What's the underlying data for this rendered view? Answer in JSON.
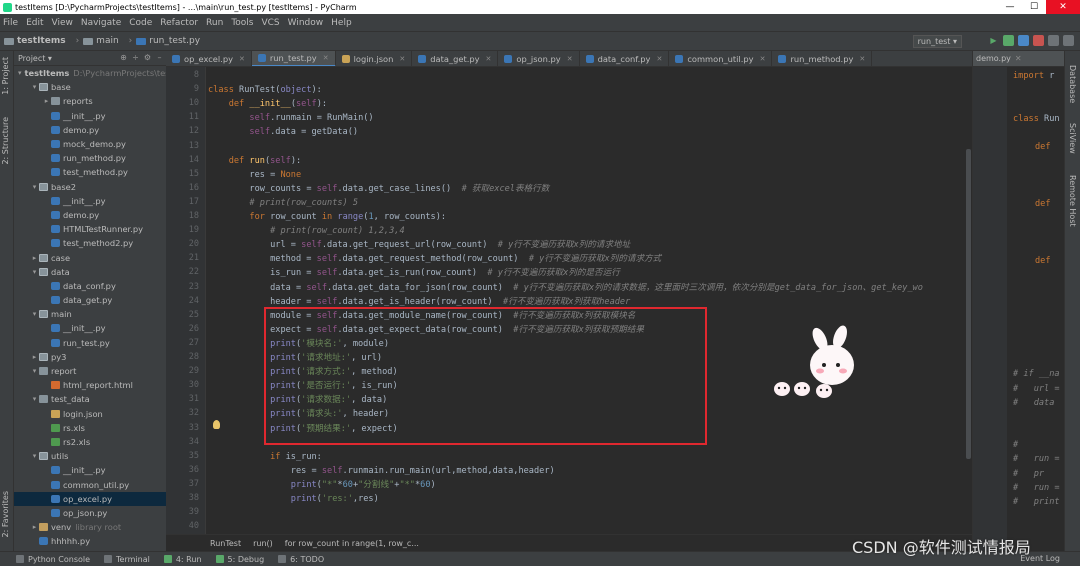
{
  "window": {
    "title": "testItems [D:\\PycharmProjects\\testItems] - ...\\main\\run_test.py [testItems] - PyCharm",
    "min": "—",
    "max": "☐",
    "close": "✕"
  },
  "menu": [
    "File",
    "Edit",
    "View",
    "Navigate",
    "Code",
    "Refactor",
    "Run",
    "Tools",
    "VCS",
    "Window",
    "Help"
  ],
  "breadcrumb": [
    "testItems",
    "main",
    "run_test.py"
  ],
  "run_config": "run_test ▾",
  "project_panel": {
    "header": "Project ▾"
  },
  "left_labels": [
    "1: Project",
    "2: Structure",
    "2: Favorites"
  ],
  "right_labels": [
    "Database",
    "SciView",
    "Remote Host"
  ],
  "tree": [
    {
      "d": 0,
      "a": "▾",
      "i": "folder",
      "t": "testItems",
      "dim": "D:\\PycharmProjects\\testItems",
      "bold": true
    },
    {
      "d": 1,
      "a": "▾",
      "i": "pkg",
      "t": "base"
    },
    {
      "d": 2,
      "a": "▸",
      "i": "folder",
      "t": "reports"
    },
    {
      "d": 2,
      "a": "",
      "i": "py",
      "t": "__init__.py"
    },
    {
      "d": 2,
      "a": "",
      "i": "py",
      "t": "demo.py"
    },
    {
      "d": 2,
      "a": "",
      "i": "py",
      "t": "mock_demo.py"
    },
    {
      "d": 2,
      "a": "",
      "i": "py",
      "t": "run_method.py"
    },
    {
      "d": 2,
      "a": "",
      "i": "py",
      "t": "test_method.py"
    },
    {
      "d": 1,
      "a": "▾",
      "i": "pkg",
      "t": "base2"
    },
    {
      "d": 2,
      "a": "",
      "i": "py",
      "t": "__init__.py"
    },
    {
      "d": 2,
      "a": "",
      "i": "py",
      "t": "demo.py"
    },
    {
      "d": 2,
      "a": "",
      "i": "py",
      "t": "HTMLTestRunner.py"
    },
    {
      "d": 2,
      "a": "",
      "i": "py",
      "t": "test_method2.py"
    },
    {
      "d": 1,
      "a": "▸",
      "i": "pkg",
      "t": "case"
    },
    {
      "d": 1,
      "a": "▾",
      "i": "pkg",
      "t": "data"
    },
    {
      "d": 2,
      "a": "",
      "i": "py",
      "t": "data_conf.py"
    },
    {
      "d": 2,
      "a": "",
      "i": "py",
      "t": "data_get.py"
    },
    {
      "d": 1,
      "a": "▾",
      "i": "pkg",
      "t": "main"
    },
    {
      "d": 2,
      "a": "",
      "i": "py",
      "t": "__init__.py"
    },
    {
      "d": 2,
      "a": "",
      "i": "py",
      "t": "run_test.py"
    },
    {
      "d": 1,
      "a": "▸",
      "i": "pkg",
      "t": "py3"
    },
    {
      "d": 1,
      "a": "▾",
      "i": "folder",
      "t": "report"
    },
    {
      "d": 2,
      "a": "",
      "i": "html",
      "t": "html_report.html"
    },
    {
      "d": 1,
      "a": "▾",
      "i": "folder",
      "t": "test_data"
    },
    {
      "d": 2,
      "a": "",
      "i": "json",
      "t": "login.json"
    },
    {
      "d": 2,
      "a": "",
      "i": "xls",
      "t": "rs.xls"
    },
    {
      "d": 2,
      "a": "",
      "i": "xls",
      "t": "rs2.xls"
    },
    {
      "d": 1,
      "a": "▾",
      "i": "pkg",
      "t": "utils"
    },
    {
      "d": 2,
      "a": "",
      "i": "py",
      "t": "__init__.py"
    },
    {
      "d": 2,
      "a": "",
      "i": "py",
      "t": "common_util.py"
    },
    {
      "d": 2,
      "a": "",
      "i": "py",
      "t": "op_excel.py",
      "sel": true
    },
    {
      "d": 2,
      "a": "",
      "i": "py",
      "t": "op_json.py"
    },
    {
      "d": 1,
      "a": "▸",
      "i": "venv",
      "t": "venv",
      "dim": "library root"
    },
    {
      "d": 1,
      "a": "",
      "i": "py",
      "t": "hhhhh.py"
    }
  ],
  "tabs": [
    {
      "t": "op_excel.py",
      "j": false
    },
    {
      "t": "run_test.py",
      "j": false,
      "active": true
    },
    {
      "t": "login.json",
      "j": true
    },
    {
      "t": "data_get.py",
      "j": false
    },
    {
      "t": "op_json.py",
      "j": false
    },
    {
      "t": "data_conf.py",
      "j": false
    },
    {
      "t": "common_util.py",
      "j": false
    },
    {
      "t": "run_method.py",
      "j": false
    }
  ],
  "code_lines": [
    {
      "n": "8",
      "s": []
    },
    {
      "n": "9",
      "s": [
        [
          "kw",
          "class "
        ],
        [
          "",
          "RunTest("
        ],
        [
          "bi",
          "object"
        ],
        [
          "",
          "):"
        ]
      ]
    },
    {
      "n": "10",
      "s": [
        [
          "ws",
          "    "
        ],
        [
          "kw",
          "def "
        ],
        [
          "fn",
          "__init__"
        ],
        [
          "",
          "("
        ],
        [
          "self",
          "self"
        ],
        [
          "",
          "):"
        ]
      ]
    },
    {
      "n": "11",
      "s": [
        [
          "ws",
          "        "
        ],
        [
          "self",
          "self"
        ],
        [
          "",
          "."
        ],
        [
          "",
          "runmain = RunMain()"
        ]
      ]
    },
    {
      "n": "12",
      "s": [
        [
          "ws",
          "        "
        ],
        [
          "self",
          "self"
        ],
        [
          "",
          ".data = getData()"
        ]
      ]
    },
    {
      "n": "13",
      "s": []
    },
    {
      "n": "14",
      "s": [
        [
          "ws",
          "    "
        ],
        [
          "kw",
          "def "
        ],
        [
          "fn",
          "run"
        ],
        [
          "",
          "("
        ],
        [
          "self",
          "self"
        ],
        [
          "",
          "):"
        ]
      ]
    },
    {
      "n": "15",
      "s": [
        [
          "ws",
          "        "
        ],
        [
          "",
          "res = "
        ],
        [
          "kw",
          "None"
        ]
      ]
    },
    {
      "n": "16",
      "s": [
        [
          "ws",
          "        "
        ],
        [
          "",
          "row_counts = "
        ],
        [
          "self",
          "self"
        ],
        [
          "",
          ".data.get_case_lines()  "
        ],
        [
          "cm",
          "# 获取excel表格行数"
        ]
      ]
    },
    {
      "n": "17",
      "s": [
        [
          "ws",
          "        "
        ],
        [
          "cm",
          "# print(row_counts) 5"
        ]
      ]
    },
    {
      "n": "18",
      "s": [
        [
          "ws",
          "        "
        ],
        [
          "kw",
          "for "
        ],
        [
          "",
          "row_count "
        ],
        [
          "kw",
          "in "
        ],
        [
          "bi",
          "range"
        ],
        [
          "",
          "("
        ],
        [
          "num",
          "1"
        ],
        [
          "",
          ", row_counts):"
        ]
      ]
    },
    {
      "n": "19",
      "s": [
        [
          "ws",
          "            "
        ],
        [
          "cm",
          "# print(row_count) 1,2,3,4"
        ]
      ]
    },
    {
      "n": "20",
      "s": [
        [
          "ws",
          "            "
        ],
        [
          "",
          "url = "
        ],
        [
          "self",
          "self"
        ],
        [
          "",
          ".data.get_request_url(row_count)  "
        ],
        [
          "cm",
          "# y行不变遍历获取x列的请求地址"
        ]
      ]
    },
    {
      "n": "21",
      "s": [
        [
          "ws",
          "            "
        ],
        [
          "",
          "method = "
        ],
        [
          "self",
          "self"
        ],
        [
          "",
          ".data.get_request_method(row_count)  "
        ],
        [
          "cm",
          "# y行不变遍历获取x列的请求方式"
        ]
      ]
    },
    {
      "n": "22",
      "s": [
        [
          "ws",
          "            "
        ],
        [
          "",
          "is_run = "
        ],
        [
          "self",
          "self"
        ],
        [
          "",
          ".data.get_is_run(row_count)  "
        ],
        [
          "cm",
          "# y行不变遍历获取x列的是否运行"
        ]
      ]
    },
    {
      "n": "23",
      "s": [
        [
          "ws",
          "            "
        ],
        [
          "",
          "data = "
        ],
        [
          "self",
          "self"
        ],
        [
          "",
          ".data.get_data_for_json(row_count)  "
        ],
        [
          "cm",
          "# y行不变遍历获取x列的请求数据，这里面时三次调用，依次分别是get_data_for_json、get_key_wo"
        ]
      ]
    },
    {
      "n": "24",
      "s": [
        [
          "ws",
          "            "
        ],
        [
          "",
          "header = "
        ],
        [
          "self",
          "self"
        ],
        [
          "",
          ".data.get_is_header(row_count)  "
        ],
        [
          "cm",
          "#行不变遍历获取x列获取header"
        ]
      ]
    },
    {
      "n": "25",
      "s": [
        [
          "ws",
          "            "
        ],
        [
          "",
          "module = "
        ],
        [
          "self",
          "self"
        ],
        [
          "",
          ".data.get_module_name(row_count)  "
        ],
        [
          "cm",
          "#行不变遍历获取x列获取模块名"
        ]
      ]
    },
    {
      "n": "26",
      "s": [
        [
          "ws",
          "            "
        ],
        [
          "",
          "expect = "
        ],
        [
          "self",
          "self"
        ],
        [
          "",
          ".data.get_expect_data(row_count)  "
        ],
        [
          "cm",
          "#行不变遍历获取x列获取预期结果"
        ]
      ]
    },
    {
      "n": "27",
      "s": [
        [
          "ws",
          "            "
        ],
        [
          "bi",
          "print"
        ],
        [
          "",
          "("
        ],
        [
          "str",
          "'模块名:'"
        ],
        [
          "",
          ", module)"
        ]
      ]
    },
    {
      "n": "28",
      "s": [
        [
          "ws",
          "            "
        ],
        [
          "bi",
          "print"
        ],
        [
          "",
          "("
        ],
        [
          "str",
          "'请求地址:'"
        ],
        [
          "",
          ", url)"
        ]
      ]
    },
    {
      "n": "29",
      "s": [
        [
          "ws",
          "            "
        ],
        [
          "bi",
          "print"
        ],
        [
          "",
          "("
        ],
        [
          "str",
          "'请求方式:'"
        ],
        [
          "",
          ", method)"
        ]
      ]
    },
    {
      "n": "30",
      "s": [
        [
          "ws",
          "            "
        ],
        [
          "bi",
          "print"
        ],
        [
          "",
          "("
        ],
        [
          "str",
          "'是否运行:'"
        ],
        [
          "",
          ", is_run)"
        ]
      ]
    },
    {
      "n": "31",
      "s": [
        [
          "ws",
          "            "
        ],
        [
          "bi",
          "print"
        ],
        [
          "",
          "("
        ],
        [
          "str",
          "'请求数据:'"
        ],
        [
          "",
          ", data)"
        ]
      ]
    },
    {
      "n": "32",
      "s": [
        [
          "ws",
          "            "
        ],
        [
          "bi",
          "print"
        ],
        [
          "",
          "("
        ],
        [
          "str",
          "'请求头:'"
        ],
        [
          "",
          ", header)"
        ]
      ]
    },
    {
      "n": "33",
      "s": [
        [
          "ws",
          "            "
        ],
        [
          "bi",
          "print"
        ],
        [
          "",
          "("
        ],
        [
          "str",
          "'预期结果:'"
        ],
        [
          "",
          ", expect)"
        ]
      ]
    },
    {
      "n": "34",
      "s": []
    },
    {
      "n": "35",
      "s": [
        [
          "ws",
          "            "
        ],
        [
          "kw",
          "if "
        ],
        [
          "",
          "is_run:"
        ]
      ]
    },
    {
      "n": "36",
      "s": [
        [
          "ws",
          "                "
        ],
        [
          "",
          "res = "
        ],
        [
          "self",
          "self"
        ],
        [
          "",
          ".runmain.run_main(url,method,data,header)"
        ]
      ]
    },
    {
      "n": "37",
      "s": [
        [
          "ws",
          "                "
        ],
        [
          "bi",
          "print"
        ],
        [
          "",
          "("
        ],
        [
          "str",
          "\"*\""
        ],
        [
          "",
          "*"
        ],
        [
          "num",
          "60"
        ],
        [
          "",
          "+"
        ],
        [
          "str",
          "\"分割线\""
        ],
        [
          "",
          "+"
        ],
        [
          "str",
          "\"*\""
        ],
        [
          "",
          "*"
        ],
        [
          "num",
          "60"
        ],
        [
          "",
          ")"
        ]
      ]
    },
    {
      "n": "38",
      "s": [
        [
          "ws",
          "                "
        ],
        [
          "bi",
          "print"
        ],
        [
          "",
          "("
        ],
        [
          "str",
          "'res:'"
        ],
        [
          "",
          ",res)"
        ]
      ]
    },
    {
      "n": "39",
      "s": []
    },
    {
      "n": "40",
      "s": []
    }
  ],
  "editor_crumbs": [
    "RunTest",
    "run()",
    "for row_count in range(1, row_c..."
  ],
  "right_panel": {
    "tab": "demo.py",
    "lines": [
      [
        [
          "kw",
          "import "
        ],
        [
          "",
          "r"
        ]
      ],
      [
        [
          "kw",
          "class "
        ],
        [
          "",
          "Run"
        ]
      ],
      [
        [
          "kw",
          "def"
        ]
      ],
      [
        [
          "kw",
          "def"
        ]
      ],
      [
        [
          "kw",
          "def"
        ]
      ],
      [
        [
          "cm",
          "# if __na"
        ]
      ],
      [
        [
          "cm",
          "#   url ="
        ]
      ],
      [
        [
          "cm",
          "#   data"
        ]
      ],
      [
        [
          "cm",
          "#"
        ]
      ],
      [
        [
          "cm",
          "#   run ="
        ]
      ],
      [
        [
          "cm",
          "#   pr"
        ]
      ],
      [
        [
          "cm",
          "#   run ="
        ]
      ],
      [
        [
          "cm",
          "#   print"
        ]
      ]
    ]
  },
  "status": [
    "Python Console",
    "Terminal",
    "4: Run",
    "5: Debug",
    "6: TODO"
  ],
  "event_log": "Event Log",
  "watermark": "CSDN @软件测试情报局"
}
